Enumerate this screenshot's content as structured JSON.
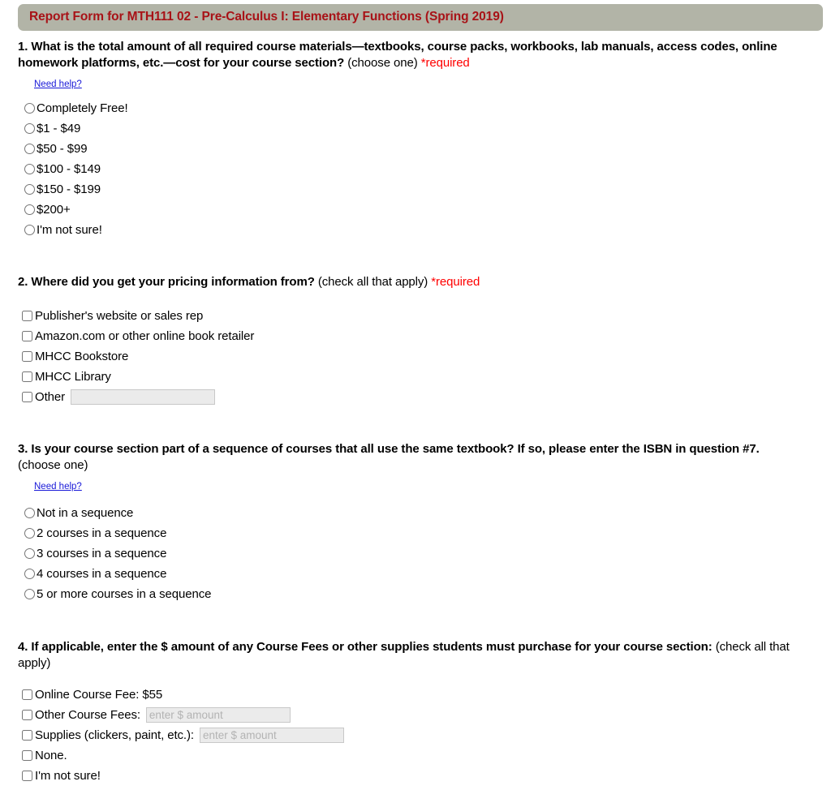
{
  "header": {
    "title": "Report Form for MTH111 02 - Pre-Calculus I: Elementary Functions (Spring 2019)"
  },
  "colors": {
    "banner_background": "#b2b4a7",
    "banner_text": "#a81217",
    "required_text": "#ff0000",
    "link_text": "#1818d8",
    "input_background": "#ebebeb",
    "page_background": "#ffffff"
  },
  "help_link_label": "Need help?",
  "questions": [
    {
      "number": "1.",
      "prompt": "What is the total amount of all required course materials—textbooks, course packs, workbooks, lab manuals, access codes, online homework platforms, etc.—cost for your course section?",
      "instruction": "(choose one)",
      "required_label": "*required",
      "input_type": "radio",
      "options": [
        {
          "label": "Completely Free!"
        },
        {
          "label": "$1 - $49"
        },
        {
          "label": "$50 - $99"
        },
        {
          "label": "$100 - $149"
        },
        {
          "label": "$150 - $199"
        },
        {
          "label": "$200+"
        },
        {
          "label": "I'm not sure!"
        }
      ]
    },
    {
      "number": "2.",
      "prompt": "Where did you get your pricing information from?",
      "instruction": "(check all that apply)",
      "required_label": "*required",
      "input_type": "checkbox",
      "options": [
        {
          "label": "Publisher's website or sales rep"
        },
        {
          "label": "Amazon.com or other online book retailer"
        },
        {
          "label": "MHCC Bookstore"
        },
        {
          "label": "MHCC Library"
        },
        {
          "label": "Other",
          "text_value": "",
          "text_placeholder": ""
        }
      ]
    },
    {
      "number": "3.",
      "prompt": "Is your course section part of a sequence of courses that all use the same textbook? If so, please enter the ISBN in question #7.",
      "instruction": "(choose one)",
      "required_label": "",
      "input_type": "radio",
      "options": [
        {
          "label": "Not in a sequence"
        },
        {
          "label": "2 courses in a sequence"
        },
        {
          "label": "3 courses in a sequence"
        },
        {
          "label": "4 courses in a sequence"
        },
        {
          "label": "5 or more courses in a sequence"
        }
      ]
    },
    {
      "number": "4.",
      "prompt": "If applicable, enter the $ amount of any Course Fees or other supplies students must purchase for your course section:",
      "instruction": "(check all that apply)",
      "required_label": "",
      "input_type": "checkbox",
      "options": [
        {
          "label": "Online Course Fee: $55"
        },
        {
          "label": "Other Course Fees:",
          "text_value": "",
          "text_placeholder": "enter $ amount"
        },
        {
          "label": "Supplies (clickers, paint, etc.):",
          "text_value": "",
          "text_placeholder": "enter $ amount"
        },
        {
          "label": "None."
        },
        {
          "label": "I'm not sure!"
        }
      ]
    }
  ]
}
